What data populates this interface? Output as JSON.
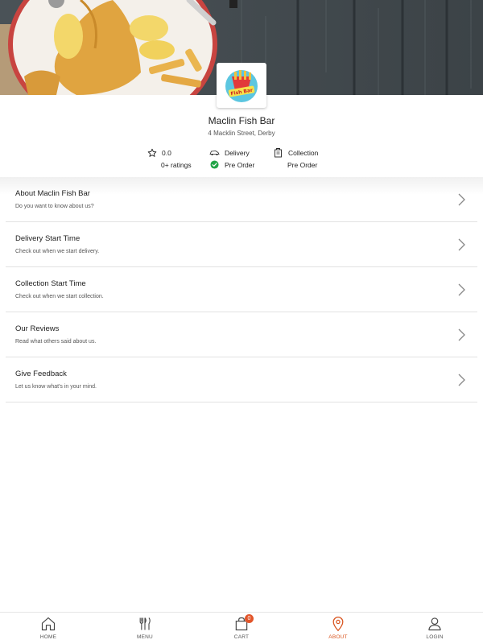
{
  "restaurant": {
    "name": "Maclin Fish Bar",
    "address": "4 Macklin Street, Derby"
  },
  "stats": {
    "rating": "0.0",
    "ratings_count": "0+ ratings",
    "delivery_label": "Delivery",
    "delivery_status": "Pre Order",
    "collection_label": "Collection",
    "collection_status": "Pre Order"
  },
  "menu_items": [
    {
      "title": "About Maclin Fish Bar",
      "subtitle": "Do you want to know about us?"
    },
    {
      "title": "Delivery Start Time",
      "subtitle": "Check out when we start delivery."
    },
    {
      "title": "Collection Start Time",
      "subtitle": "Check out when we start collection."
    },
    {
      "title": "Our Reviews",
      "subtitle": "Read what others said about us."
    },
    {
      "title": "Give Feedback",
      "subtitle": "Let us know what's in your mind."
    }
  ],
  "nav": {
    "home": "HOME",
    "menu": "MENU",
    "cart": "CART",
    "cart_count": "0",
    "about": "ABOUT",
    "login": "LOGIN",
    "active": "about"
  },
  "colors": {
    "accent": "#d9541e",
    "badge": "#e2552a",
    "status_green": "#22a447"
  },
  "icons": [
    "star-icon",
    "delivery-van-icon",
    "check-circle-icon",
    "collection-bag-icon",
    "chevron-right-icon",
    "home-icon",
    "cutlery-icon",
    "shopping-bag-icon",
    "location-pin-icon",
    "user-icon"
  ]
}
